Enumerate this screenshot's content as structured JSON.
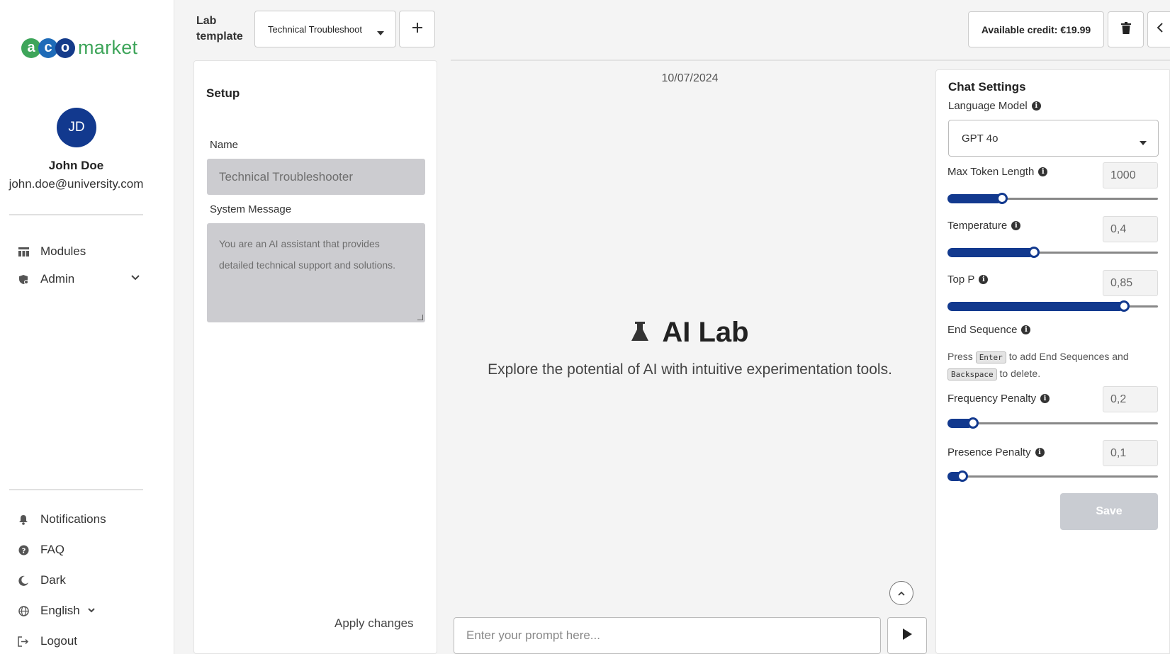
{
  "brand": {
    "logo_letters": [
      "a",
      "c",
      "o"
    ],
    "logo_word": "market",
    "primary_color": "#12398e",
    "green": "#3ea55a"
  },
  "user": {
    "initials": "JD",
    "name": "John Doe",
    "email": "john.doe@university.com"
  },
  "nav": {
    "modules": "Modules",
    "admin": "Admin",
    "notifications": "Notifications",
    "faq": "FAQ",
    "dark": "Dark",
    "language": "English",
    "logout": "Logout"
  },
  "topbar": {
    "lab_template_label": "Lab\ntemplate",
    "template_selected": "Technical Troubleshoot",
    "credit": "Available credit: €19.99"
  },
  "setup": {
    "title": "Setup",
    "name_label": "Name",
    "name_value": "Technical Troubleshooter",
    "system_label": "System Message",
    "system_value": "You are an AI assistant that provides detailed technical support and solutions.",
    "apply_label": "Apply changes"
  },
  "chat": {
    "date": "10/07/2024",
    "hero_title": "AI Lab",
    "hero_subtitle": "Explore the potential of AI with intuitive experimentation tools.",
    "prompt_placeholder": "Enter your prompt here..."
  },
  "settings": {
    "title": "Chat Settings",
    "language_model_label": "Language Model",
    "language_model_value": "GPT 4o",
    "max_token_label": "Max Token Length",
    "max_token_value": "1000",
    "max_token_fraction": 0.26,
    "temperature_label": "Temperature",
    "temperature_value": "0,4",
    "temperature_fraction": 0.41,
    "top_p_label": "Top P",
    "top_p_value": "0,85",
    "top_p_fraction": 0.84,
    "end_sequence_label": "End Sequence",
    "end_help_press": "Press",
    "end_help_enter_key": "Enter",
    "end_help_mid": "to add End Sequences and",
    "end_help_backspace_key": "Backspace",
    "end_help_end": "to delete.",
    "frequency_label": "Frequency Penalty",
    "frequency_value": "0,2",
    "frequency_fraction": 0.12,
    "presence_label": "Presence Penalty",
    "presence_value": "0,1",
    "presence_fraction": 0.07,
    "save_label": "Save"
  }
}
